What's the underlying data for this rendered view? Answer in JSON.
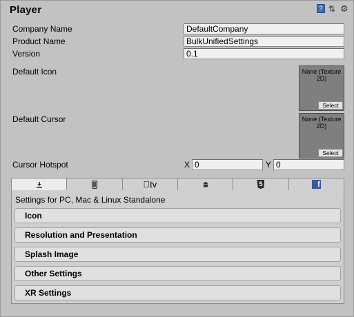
{
  "header": {
    "title": "Player",
    "icons": [
      "help-book-icon",
      "presets-icon",
      "gear-icon"
    ]
  },
  "fields": {
    "company_name": {
      "label": "Company Name",
      "value": "DefaultCompany"
    },
    "product_name": {
      "label": "Product Name",
      "value": "BulkUnifiedSettings"
    },
    "version": {
      "label": "Version",
      "value": "0.1"
    }
  },
  "default_icon": {
    "label": "Default Icon",
    "texture": "None (Texture 2D)",
    "select_label": "Select"
  },
  "default_cursor": {
    "label": "Default Cursor",
    "texture": "None (Texture 2D)",
    "select_label": "Select"
  },
  "cursor_hotspot": {
    "label": "Cursor Hotspot",
    "x_label": "X",
    "x_value": "0",
    "y_label": "Y",
    "y_value": "0"
  },
  "platform_tabs": [
    {
      "icon": "standalone-download-icon",
      "selected": true
    },
    {
      "icon": "mobile-device-icon",
      "selected": false
    },
    {
      "icon": "apple-tv-icon",
      "label": "tv",
      "selected": false
    },
    {
      "icon": "android-icon",
      "selected": false
    },
    {
      "icon": "html5-icon",
      "label": "5",
      "selected": false
    },
    {
      "icon": "facebook-icon",
      "label": "f",
      "selected": false
    }
  ],
  "platform_caption": "Settings for PC, Mac & Linux Standalone",
  "sections": [
    {
      "label": "Icon"
    },
    {
      "label": "Resolution and Presentation"
    },
    {
      "label": "Splash Image"
    },
    {
      "label": "Other Settings"
    },
    {
      "label": "XR Settings"
    }
  ]
}
